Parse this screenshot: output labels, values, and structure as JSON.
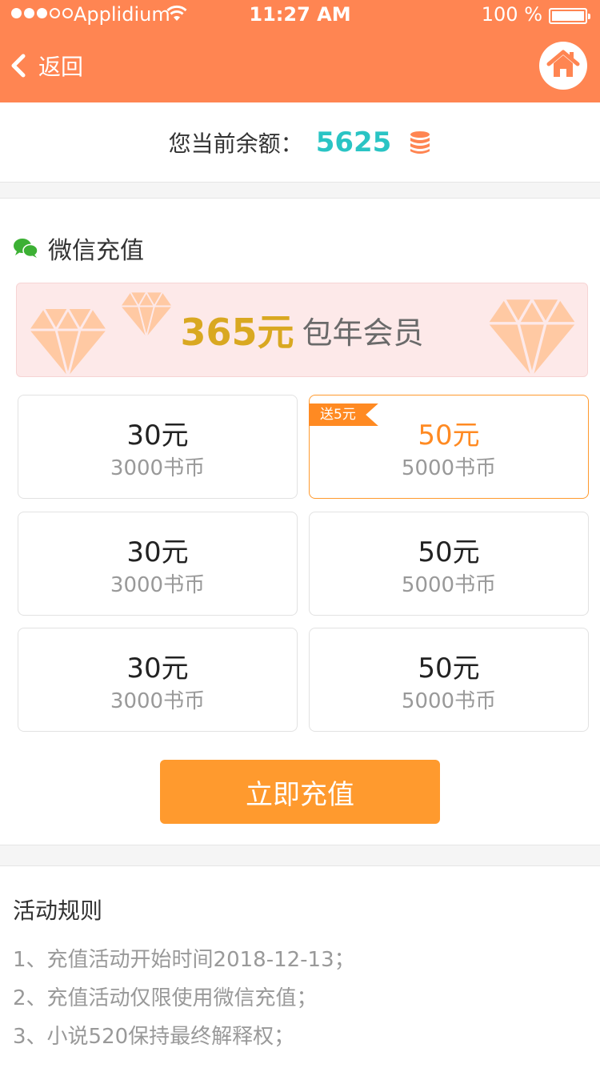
{
  "status_bar": {
    "carrier": "Applidium",
    "time": "11:27 AM",
    "battery": "100 %"
  },
  "nav": {
    "back_label": "返回",
    "icons": {
      "back": "chevron-left-icon",
      "home": "home-icon"
    }
  },
  "balance": {
    "label": "您当前余额：",
    "value": "5625",
    "icon": "coin-stack-icon"
  },
  "recharge": {
    "title": "微信充值",
    "icon": "wechat-icon",
    "annual": {
      "price": "365元",
      "label": "包年会员"
    },
    "packages": [
      {
        "price": "30元",
        "coins": "3000书币",
        "selected": false,
        "badge": ""
      },
      {
        "price": "50元",
        "coins": "5000书币",
        "selected": true,
        "badge": "送5元"
      },
      {
        "price": "30元",
        "coins": "3000书币",
        "selected": false,
        "badge": ""
      },
      {
        "price": "50元",
        "coins": "5000书币",
        "selected": false,
        "badge": ""
      },
      {
        "price": "30元",
        "coins": "3000书币",
        "selected": false,
        "badge": ""
      },
      {
        "price": "50元",
        "coins": "5000书币",
        "selected": false,
        "badge": ""
      }
    ],
    "submit_label": "立即充值"
  },
  "rules": {
    "title": "活动规则",
    "items": [
      "1、充值活动开始时间2018-12-13；",
      "2、充值活动仅限使用微信充值；",
      "3、小说520保持最终解释权；"
    ]
  },
  "colors": {
    "header": "#ff8552",
    "accent": "#ff9a2e",
    "balance_value": "#2ac4c4",
    "annual_price": "#d9a821",
    "wechat_green": "#3cb034"
  }
}
